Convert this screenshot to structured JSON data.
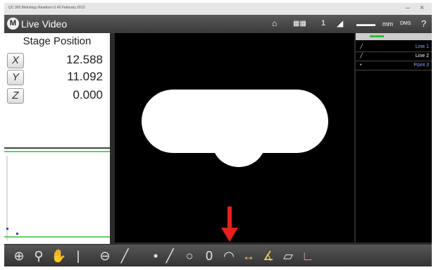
{
  "titlebar": {
    "title": "QC 300 Metrology Readout v1.40 February 2013"
  },
  "header": {
    "logo": "M",
    "title": "Live Video",
    "count": "1",
    "unit": "mm",
    "help": "?"
  },
  "stage": {
    "title": "Stage Position",
    "axes": [
      {
        "label": "X",
        "value": "12.588"
      },
      {
        "label": "Y",
        "value": "11.092"
      },
      {
        "label": "Z",
        "value": "0.000"
      }
    ]
  },
  "features": [
    {
      "icon": "line-icon",
      "label": "Line 1",
      "color": "#8fa8ff"
    },
    {
      "icon": "line-icon",
      "label": "Line 2",
      "color": "#ffffff"
    },
    {
      "icon": "point-icon",
      "label": "Point 3",
      "color": "#8fa8ff"
    }
  ],
  "toolbar": {
    "tools": [
      "target-icon",
      "zoom-icon",
      "hand-icon",
      "bar-icon",
      "probe-icon",
      "edge-icon",
      "point-icon",
      "line-icon",
      "circle-icon",
      "slot-icon",
      "arc-icon",
      "distance-icon",
      "angle-icon",
      "plane-icon",
      "axis-icon"
    ]
  },
  "colors": {
    "accent_green": "#2fc22f",
    "arrow": "#e8201b"
  }
}
